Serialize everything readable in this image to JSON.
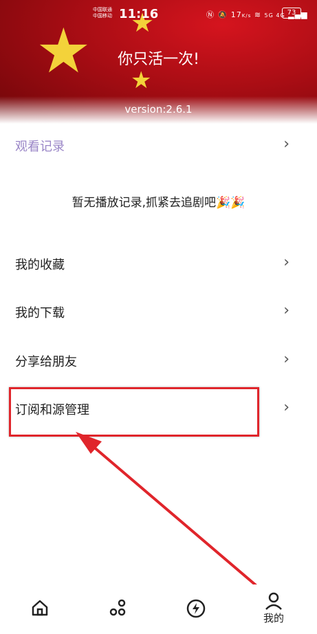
{
  "status_bar": {
    "carrier1": "中国联通",
    "carrier2": "中国移动",
    "time": "11:16",
    "net_speed_value": "17",
    "net_speed_unit": "K/s",
    "network_labels": "5G 4G",
    "battery": "73"
  },
  "header": {
    "app_title": "你只活一次!",
    "version": "version:2.6.1"
  },
  "menu": {
    "history_label": "观看记录",
    "empty_message": "暂无播放记录,抓紧去追剧吧🎉🎉",
    "items": [
      {
        "label": "我的收藏"
      },
      {
        "label": "我的下载"
      },
      {
        "label": "分享给朋友"
      },
      {
        "label": "订阅和源管理"
      }
    ]
  },
  "bottom_nav": {
    "items": [
      {
        "icon": "home-icon"
      },
      {
        "icon": "discover-icon"
      },
      {
        "icon": "lightning-icon"
      },
      {
        "icon": "user-icon",
        "label": "我的"
      }
    ]
  },
  "annotation": {
    "highlight_color": "#e0252b",
    "target": "订阅和源管理"
  }
}
